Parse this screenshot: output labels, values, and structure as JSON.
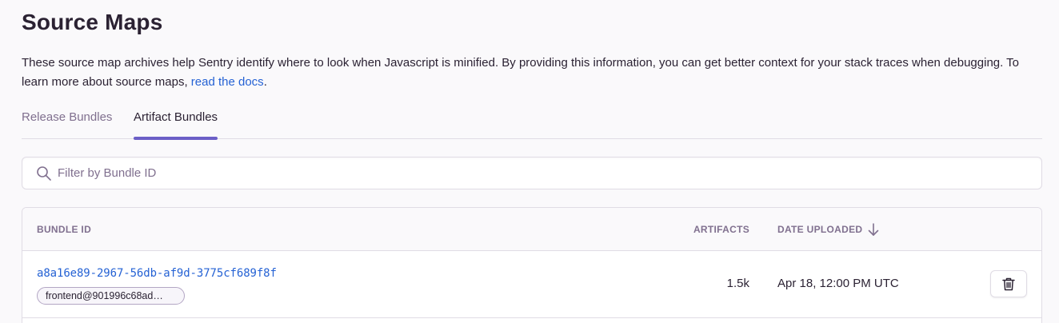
{
  "page": {
    "title": "Source Maps",
    "description_prefix": "These source map archives help Sentry identify where to look when Javascript is minified. By providing this information, you can get better context for your stack traces when debugging. To learn more about source maps, ",
    "docs_link": "read the docs",
    "description_suffix": "."
  },
  "tabs": [
    {
      "label": "Release Bundles",
      "active": false
    },
    {
      "label": "Artifact Bundles",
      "active": true
    }
  ],
  "search": {
    "placeholder": "Filter by Bundle ID",
    "value": "",
    "icon": "search-icon"
  },
  "table": {
    "headers": {
      "bundle_id": "Bundle ID",
      "artifacts": "Artifacts",
      "date_uploaded": "Date Uploaded"
    },
    "sort": {
      "column": "date_uploaded",
      "direction": "descending",
      "icon": "arrow-down-icon"
    },
    "rows": [
      {
        "bundle_id": "a8a16e89-2967-56db-af9d-3775cf689f8f",
        "tag": "frontend@901996c68ad…",
        "artifacts": "1.5k",
        "date_uploaded": "Apr 18, 12:00 PM UTC",
        "action_icon": "trash-icon"
      }
    ]
  },
  "colors": {
    "accent": "#6c5fc7",
    "link": "#2562d4",
    "text": "#2b2233",
    "muted": "#80708f",
    "border": "#e0dce5",
    "background": "#faf9fb"
  }
}
